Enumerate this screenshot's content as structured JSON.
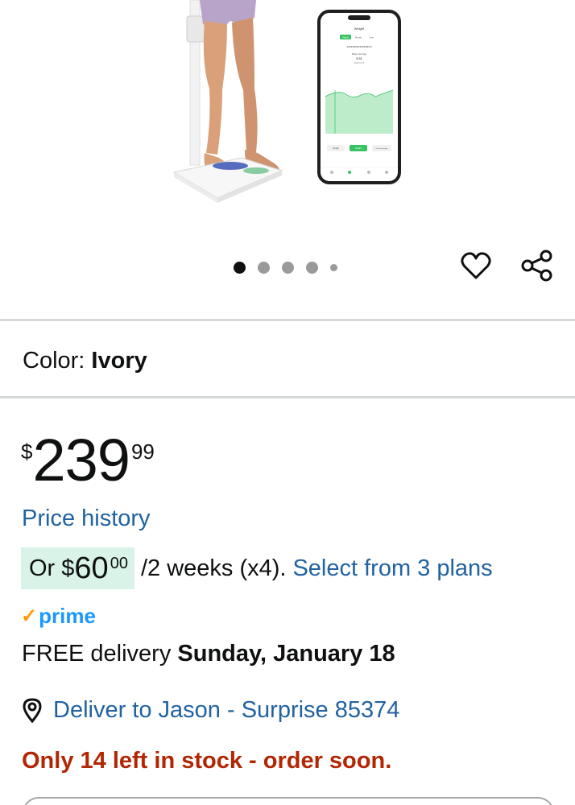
{
  "gallery": {
    "image_count": 5,
    "active_index": 0,
    "phone_screen": {
      "header": "Weight",
      "tabs": [
        "Week",
        "Month",
        "Year"
      ],
      "date_range": "2023/09/08-2023/09/15",
      "stat_label": "Daily Average",
      "stat_value": "5.51",
      "stat_date": "2023.10.04",
      "buttons": [
        "Weight",
        "Height",
        "Fat percentage"
      ]
    }
  },
  "icons": {
    "favorite": "heart-outline-icon",
    "share": "share-icon",
    "location": "location-pin-icon",
    "prime_check": "prime-check-icon"
  },
  "colors": {
    "link": "#2162a1",
    "stock_warning": "#b12704",
    "prime_blue": "#1a98ff",
    "prime_check": "#ff9900",
    "plan_badge_bg": "#d9f3e8"
  },
  "product": {
    "color_label": "Color:",
    "color_value": "Ivory"
  },
  "price": {
    "symbol": "$",
    "whole": "239",
    "fraction": "99"
  },
  "price_history_link": "Price history",
  "installments": {
    "prefix": "Or",
    "symbol": "$",
    "whole": "60",
    "fraction": "00",
    "period": "/2 weeks (x4).",
    "plans_link": "Select from 3 plans"
  },
  "prime": {
    "check": "✓",
    "label": "prime"
  },
  "delivery": {
    "prefix": "FREE delivery",
    "date": "Sunday, January 18"
  },
  "deliver_to": "Deliver to Jason - Surprise 85374",
  "stock_message": "Only 14 left in stock - order soon."
}
